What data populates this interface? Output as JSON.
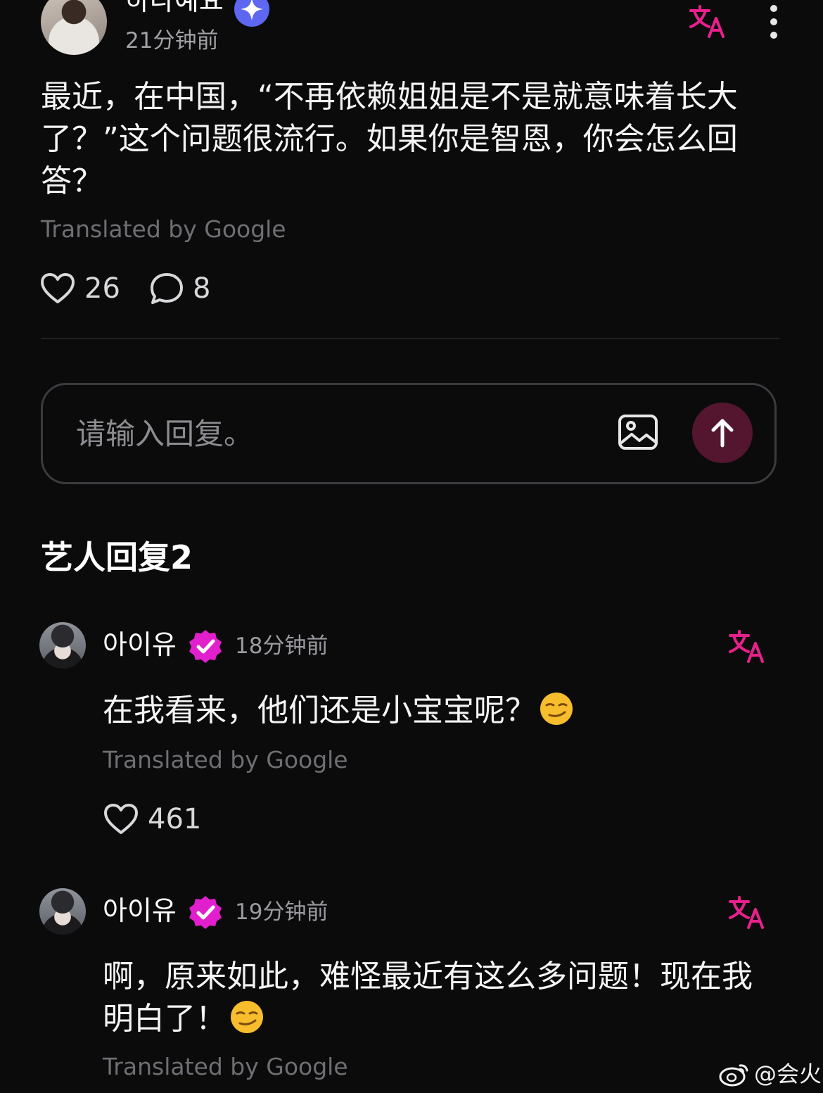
{
  "post": {
    "author": "하나예요",
    "time": "21分钟前",
    "text": "最近，在中国，“不再依赖姐姐是不是就意味着长大了？”这个问题很流行。如果你是智恩，你会怎么回答？",
    "translated_by": "Translated by Google",
    "likes": "26",
    "comments": "8",
    "icons": {
      "verified": "sparkle-badge-icon",
      "translate": "translate-icon",
      "more": "more-vertical-icon",
      "like": "heart-icon",
      "comment": "comment-bubble-icon"
    }
  },
  "reply_input": {
    "placeholder": "请输入回复。",
    "image_icon": "image-icon",
    "send_icon": "arrow-up-icon"
  },
  "section": {
    "title": "艺人回复2"
  },
  "comments": [
    {
      "author": "아이유",
      "time": "18分钟前",
      "text": "在我看来，他们还是小宝宝呢？",
      "emoji": "smirk-emoji",
      "translated_by": "Translated by Google",
      "likes": "461"
    },
    {
      "author": "아이유",
      "time": "19分钟前",
      "text": "啊，原来如此，难怪最近有这么多问题！现在我明白了！",
      "emoji": "smirk-emoji",
      "translated_by": "Translated by Google"
    }
  ],
  "watermark": {
    "text": "@会火",
    "icon": "weibo-logo-icon"
  },
  "colors": {
    "background": "#0b0b0c",
    "accent_pink": "#e8208c",
    "send_button": "#54162f",
    "sparkle_badge": "#5d67f2",
    "verified_badge": "#e21fcc"
  }
}
